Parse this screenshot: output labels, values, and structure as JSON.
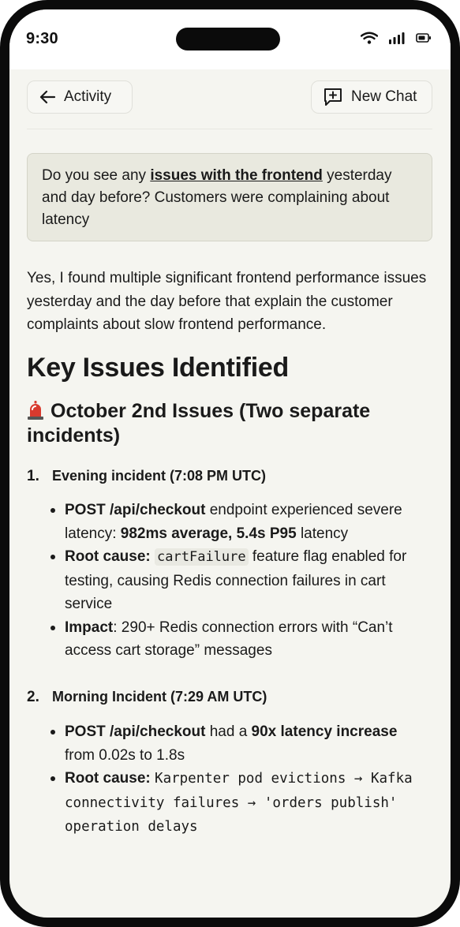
{
  "status": {
    "time": "9:30"
  },
  "header": {
    "back_label": "Activity",
    "new_chat_label": "New Chat"
  },
  "user_message": {
    "prefix": "Do you see any ",
    "emphasis": "issues with the frontend",
    "suffix": " yesterday and day before? Customers were complaining about latency"
  },
  "answer": {
    "intro": "Yes, I found multiple significant frontend performance issues yesterday and the day before that explain the customer complaints about slow frontend performance.",
    "heading": "Key Issues Identified",
    "section_title": "October 2nd Issues (Two separate incidents)",
    "incidents": [
      {
        "number": "1.",
        "title": "Evening incident (7:08 PM UTC)",
        "b1_bold": "POST /api/checkout",
        "b1_text1": " endpoint experienced severe latency: ",
        "b1_bold2": "982ms average, 5.4s P95",
        "b1_text2": " latency",
        "b2_bold": "Root cause:",
        "b2_code": "cartFailure",
        "b2_text": " feature flag enabled for testing, causing Redis connection failures in cart service",
        "b3_bold": "Impact",
        "b3_text": ": 290+ Redis connection errors with “Can’t access cart storage” messages"
      },
      {
        "number": "2.",
        "title": "Morning Incident (7:29 AM UTC)",
        "b1_bold": "POST /api/checkout",
        "b1_text1": " had a ",
        "b1_bold2": "90x latency increase",
        "b1_text2": " from 0.02s to 1.8s",
        "b2_bold": "Root cause:",
        "b2_code": "Karpenter pod evictions → Kafka connectivity failures → 'orders publish' operation delays"
      }
    ]
  },
  "colors": {
    "bubble_bg": "#e9e9df",
    "screen_bg": "#f5f5f0",
    "siren_red": "#d83a2e"
  },
  "icons": [
    "wifi-icon",
    "signal-icon",
    "battery-icon",
    "arrow-left-icon",
    "new-chat-icon",
    "siren-icon"
  ]
}
